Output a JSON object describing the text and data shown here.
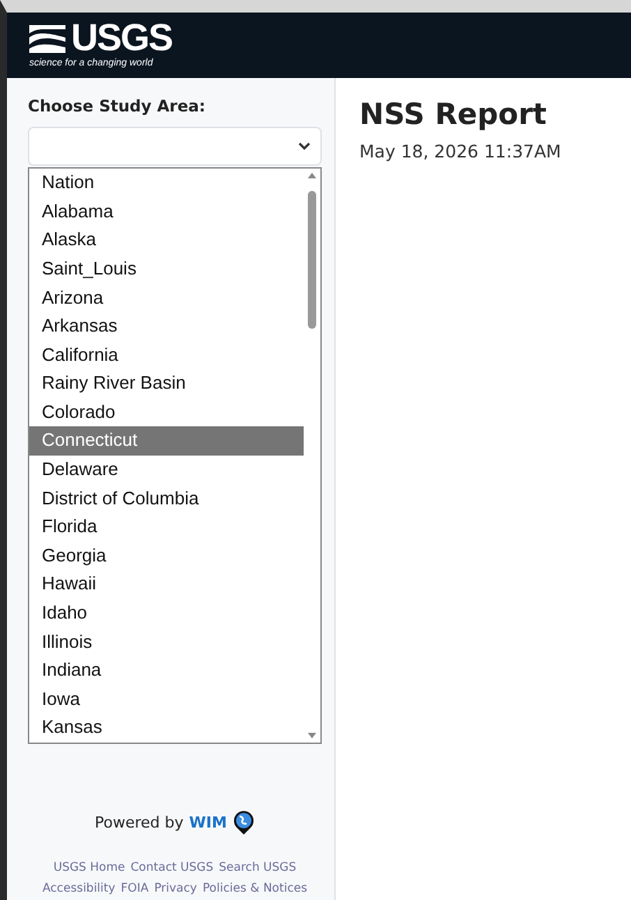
{
  "header": {
    "logo_text": "USGS",
    "tagline": "science for a changing world"
  },
  "sidebar": {
    "label": "Choose Study Area:",
    "options": [
      {
        "label": "Nation",
        "selected": false
      },
      {
        "label": "Alabama",
        "selected": false
      },
      {
        "label": "Alaska",
        "selected": false
      },
      {
        "label": "Saint_Louis",
        "selected": false
      },
      {
        "label": "Arizona",
        "selected": false
      },
      {
        "label": "Arkansas",
        "selected": false
      },
      {
        "label": "California",
        "selected": false
      },
      {
        "label": "Rainy River Basin",
        "selected": false
      },
      {
        "label": "Colorado",
        "selected": false
      },
      {
        "label": "Connecticut",
        "selected": true
      },
      {
        "label": "Delaware",
        "selected": false
      },
      {
        "label": "District of Columbia",
        "selected": false
      },
      {
        "label": "Florida",
        "selected": false
      },
      {
        "label": "Georgia",
        "selected": false
      },
      {
        "label": "Hawaii",
        "selected": false
      },
      {
        "label": "Idaho",
        "selected": false
      },
      {
        "label": "Illinois",
        "selected": false
      },
      {
        "label": "Indiana",
        "selected": false
      },
      {
        "label": "Iowa",
        "selected": false
      },
      {
        "label": "Kansas",
        "selected": false
      }
    ],
    "powered_by": "Powered by",
    "powered_brand": "WIM",
    "footer_links": [
      [
        "USGS Home",
        "Contact USGS",
        "Search USGS"
      ],
      [
        "Accessibility",
        "FOIA",
        "Privacy",
        "Policies & Notices"
      ]
    ]
  },
  "main": {
    "title": "NSS Report",
    "date": "May 18, 2026 11:37AM"
  }
}
